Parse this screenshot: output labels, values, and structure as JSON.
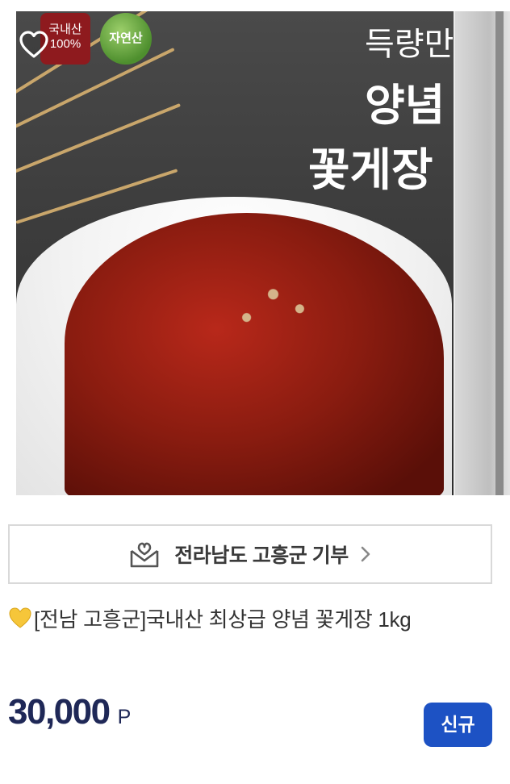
{
  "product_image": {
    "overlay_line1": "득량만",
    "overlay_line2": "양념",
    "overlay_line3": "꽃게장",
    "badge_domestic": "국내산\n100%",
    "badge_natural": "자연산"
  },
  "favorite": {
    "icon": "heart-outline-icon"
  },
  "donation": {
    "label": "전라남도 고흥군 기부",
    "icon": "gift-box-icon",
    "chevron": "chevron-right-icon"
  },
  "product": {
    "title": "[전남 고흥군]국내산 최상급 양념 꽃게장 1kg",
    "title_icon": "yellow-heart-icon"
  },
  "price": {
    "amount": "30,000",
    "unit": "P"
  },
  "badge": {
    "label": "신규"
  },
  "colors": {
    "price": "#1f2857",
    "badge_bg": "#1d52c4"
  }
}
